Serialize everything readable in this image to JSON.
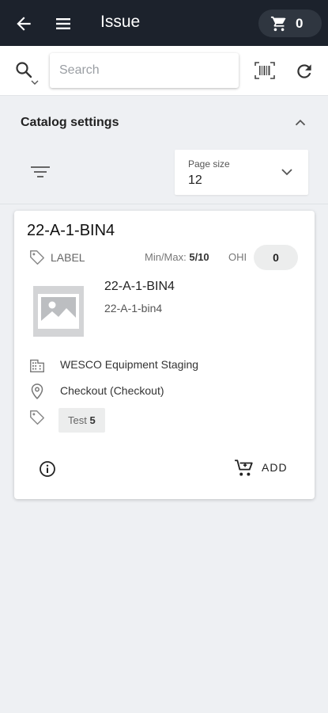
{
  "appbar": {
    "title": "Issue",
    "cart_count": "0"
  },
  "search": {
    "placeholder": "Search"
  },
  "settings": {
    "title": "Catalog settings",
    "page_size_label": "Page size",
    "page_size_value": "12"
  },
  "item": {
    "title": "22-A-1-BIN4",
    "label_text": "LABEL",
    "minmax_label": "Min/Max:",
    "minmax_value": "5/10",
    "ohi_label": "OHI",
    "ohi_value": "0",
    "product_name": "22-A-1-BIN4",
    "product_code": "22-A-1-bin4",
    "location": "WESCO Equipment Staging",
    "checkout": "Checkout (Checkout)",
    "tag_name": "Test",
    "tag_count": "5",
    "add_label": "ADD"
  },
  "colors": {
    "appbar_bg": "#1c222c",
    "page_bg": "#eef0f3",
    "chip_bg": "#eceded"
  },
  "icons": [
    "back-arrow-icon",
    "menu-icon",
    "cart-icon",
    "search-icon",
    "chevron-down-icon",
    "barcode-icon",
    "refresh-icon",
    "chevron-up-icon",
    "filter-icon",
    "tag-icon",
    "image-placeholder-icon",
    "building-icon",
    "location-pin-icon",
    "info-icon",
    "add-cart-icon"
  ]
}
